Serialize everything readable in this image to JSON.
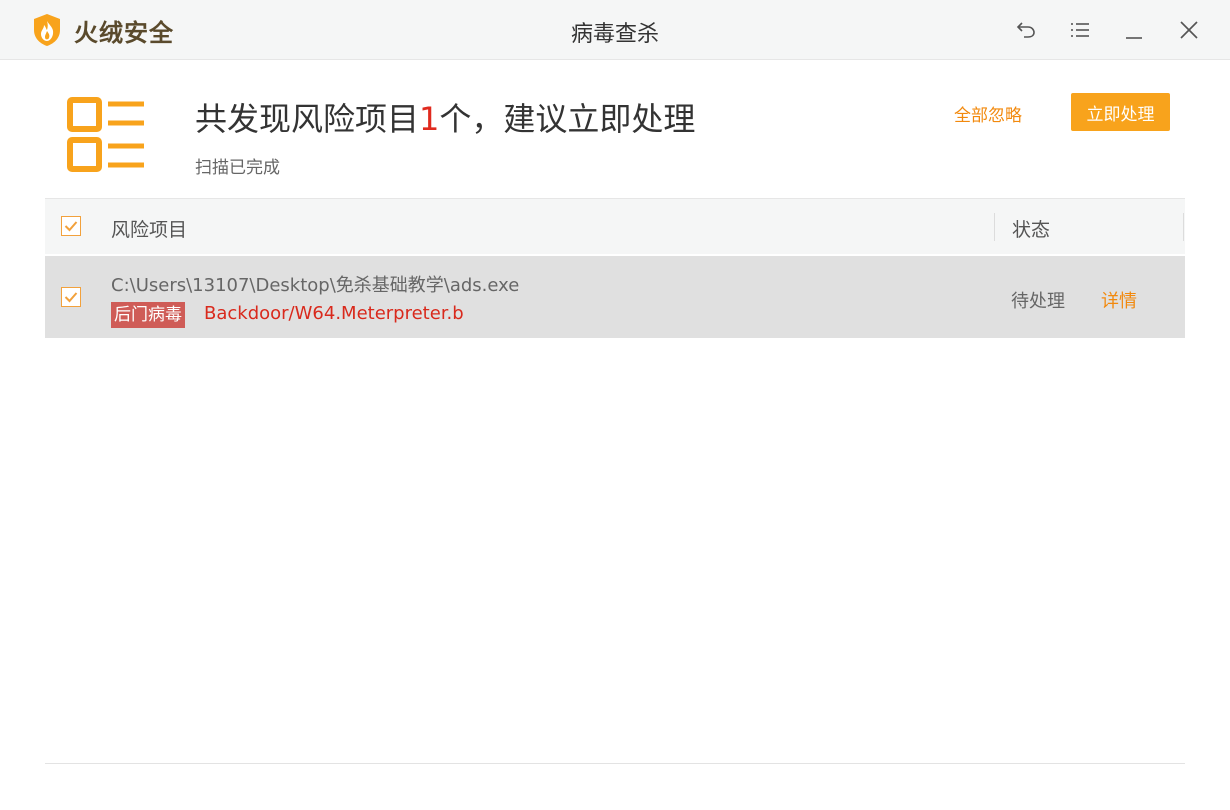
{
  "app": {
    "brand_name": "火绒安全",
    "window_title": "病毒查杀"
  },
  "icons": {
    "logo": "huorong-flame-shield-icon",
    "back": "undo-arrow-icon",
    "menu": "list-menu-icon",
    "minimize": "minimize-icon",
    "close": "close-icon",
    "summary": "risk-list-icon",
    "check": "checkmark-icon"
  },
  "summary": {
    "title_prefix": "共发现风险项目",
    "count": "1",
    "title_suffix": "个，建议立即处理",
    "subtitle": "扫描已完成",
    "ignore_all_label": "全部忽略",
    "process_now_label": "立即处理"
  },
  "table": {
    "columns": [
      "风险项目",
      "状态"
    ],
    "header_checked": true,
    "rows": [
      {
        "checked": true,
        "path": "C:\\Users\\13107\\Desktop\\免杀基础教学\\ads.exe",
        "category": "后门病毒",
        "virus_name": "Backdoor/W64.Meterpreter.b",
        "status": "待处理",
        "action": "详情"
      }
    ]
  },
  "colors": {
    "accent_orange": "#f8a31c",
    "link_orange": "#f2890d",
    "danger_red": "#d9291c",
    "tag_red": "#cf5c57",
    "row_bg": "#e0e0e0"
  }
}
